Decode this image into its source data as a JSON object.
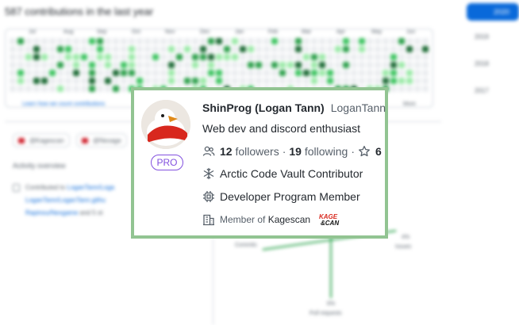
{
  "background": {
    "contributions_title": "587 contributions in the last year",
    "months": [
      "Jul",
      "Aug",
      "Sep",
      "Oct",
      "Nov",
      "Dec",
      "Jan",
      "Feb",
      "Mar",
      "Apr",
      "May",
      "Jun"
    ],
    "learn_link": "Learn how we count contributions",
    "legend_more": "More",
    "years": {
      "active": "2020",
      "others": [
        "2019",
        "2018",
        "2017"
      ]
    },
    "org_pills": [
      "@Kagescan",
      "@Nexage"
    ],
    "activity_overview": "Activity overview",
    "contributed_prefix": "Contributed to",
    "contributed_repos": [
      "LoganTann/Loga",
      "LoganTann/LoganTann.githu",
      "Rapinou/Nexgame"
    ],
    "contributed_suffix": "and 5 ot",
    "axis_labels": {
      "left": "Commits",
      "right": "Issues",
      "bottom": "Pull requests",
      "top_value": "4%",
      "bottom_value": "6%"
    }
  },
  "hovercard": {
    "display_name": "ShinProg (Logan Tann)",
    "login": "LoganTann",
    "bio": "Web dev and discord enthusiast",
    "followers_count": "12",
    "followers_label": "followers",
    "following_count": "19",
    "following_label": "following",
    "stars_count": "6",
    "badge": "PRO",
    "achievement": "Arctic Code Vault Contributor",
    "program": "Developer Program Member",
    "member_prefix": "Member of",
    "org_name": "Kagescan",
    "org_logo_text": "KAGE SCAN"
  },
  "colors": {
    "card_border": "#92c492",
    "pro": "#8250df",
    "link": "#0969da",
    "active_year": "#0969da"
  },
  "icons": [
    "people-icon",
    "star-icon",
    "snowflake-icon",
    "cpu-icon",
    "organization-icon",
    "kagescan-logo"
  ]
}
